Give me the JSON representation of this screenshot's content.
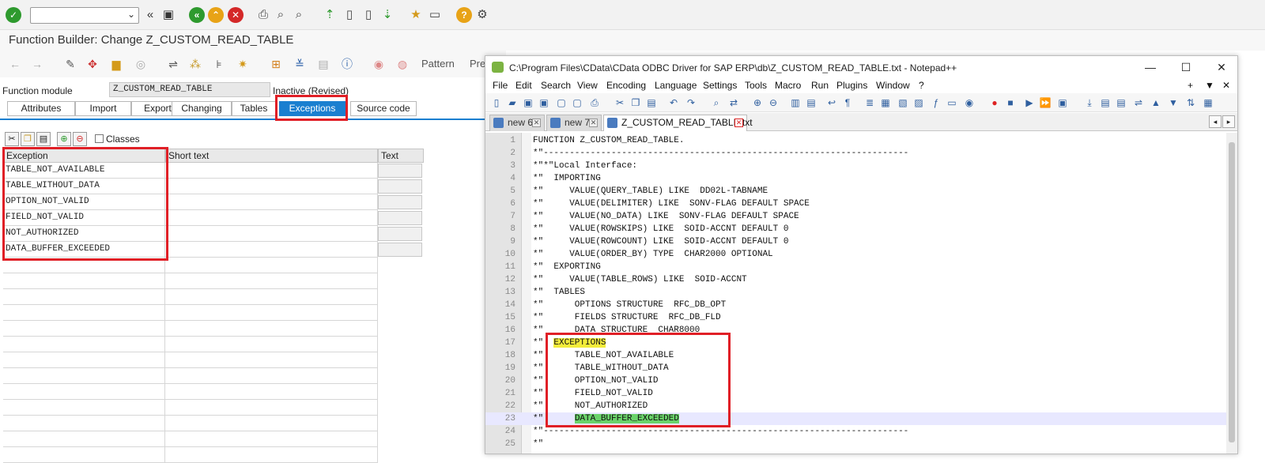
{
  "sap": {
    "title": "Function Builder: Change Z_CUSTOM_READ_TABLE",
    "app_toolbar": {
      "pattern_label": "Pattern",
      "pretty_label": "Pre"
    },
    "function_module": {
      "label": "Function module",
      "value": "Z_CUSTOM_READ_TABLE",
      "status": "Inactive (Revised)"
    },
    "tabs": [
      {
        "label": "Attributes"
      },
      {
        "label": "Import"
      },
      {
        "label": "Export"
      },
      {
        "label": "Changing"
      },
      {
        "label": "Tables"
      },
      {
        "label": "Exceptions"
      },
      {
        "label": "Source code"
      }
    ],
    "active_tab": "Exceptions",
    "classes_label": "Classes",
    "table": {
      "headers": {
        "exception": "Exception",
        "short_text": "Short text",
        "text": "Text"
      },
      "rows": [
        "TABLE_NOT_AVAILABLE",
        "TABLE_WITHOUT_DATA",
        "OPTION_NOT_VALID",
        "FIELD_NOT_VALID",
        "NOT_AUTHORIZED",
        "DATA_BUFFER_EXCEEDED"
      ]
    },
    "colors": {
      "tab_active": "#1a7fd0",
      "highlight_box": "#e01f26"
    }
  },
  "notepad": {
    "title": "C:\\Program Files\\CData\\CData ODBC Driver for SAP ERP\\db\\Z_CUSTOM_READ_TABLE.txt - Notepad++",
    "menu": [
      "File",
      "Edit",
      "Search",
      "View",
      "Encoding",
      "Language",
      "Settings",
      "Tools",
      "Macro",
      "Run",
      "Plugins",
      "Window",
      "?"
    ],
    "menu_right": [
      "+",
      "▼",
      "✕"
    ],
    "file_tabs": [
      "new 6",
      "new 7",
      "Z_CUSTOM_READ_TABLE.txt"
    ],
    "lines": [
      {
        "n": "1",
        "text": "FUNCTION Z_CUSTOM_READ_TABLE."
      },
      {
        "n": "2",
        "text": "*\"----------------------------------------------------------------------"
      },
      {
        "n": "3",
        "text": "*\"*\"Local Interface:"
      },
      {
        "n": "4",
        "text": "*\"  IMPORTING"
      },
      {
        "n": "5",
        "text": "*\"     VALUE(QUERY_TABLE) LIKE  DD02L-TABNAME"
      },
      {
        "n": "6",
        "text": "*\"     VALUE(DELIMITER) LIKE  SONV-FLAG DEFAULT SPACE"
      },
      {
        "n": "7",
        "text": "*\"     VALUE(NO_DATA) LIKE  SONV-FLAG DEFAULT SPACE"
      },
      {
        "n": "8",
        "text": "*\"     VALUE(ROWSKIPS) LIKE  SOID-ACCNT DEFAULT 0"
      },
      {
        "n": "9",
        "text": "*\"     VALUE(ROWCOUNT) LIKE  SOID-ACCNT DEFAULT 0"
      },
      {
        "n": "10",
        "text": "*\"     VALUE(ORDER_BY) TYPE  CHAR2000 OPTIONAL"
      },
      {
        "n": "11",
        "text": "*\"  EXPORTING"
      },
      {
        "n": "12",
        "text": "*\"     VALUE(TABLE_ROWS) LIKE  SOID-ACCNT"
      },
      {
        "n": "13",
        "text": "*\"  TABLES"
      },
      {
        "n": "14",
        "text": "*\"      OPTIONS STRUCTURE  RFC_DB_OPT"
      },
      {
        "n": "15",
        "text": "*\"      FIELDS STRUCTURE  RFC_DB_FLD"
      },
      {
        "n": "16",
        "text": "*\"      DATA STRUCTURE  CHAR8000"
      },
      {
        "n": "17",
        "prefix": "*\"  ",
        "hl": "EXCEPTIONS",
        "hl_type": "yellow"
      },
      {
        "n": "18",
        "text": "*\"      TABLE_NOT_AVAILABLE"
      },
      {
        "n": "19",
        "text": "*\"      TABLE_WITHOUT_DATA"
      },
      {
        "n": "20",
        "text": "*\"      OPTION_NOT_VALID"
      },
      {
        "n": "21",
        "text": "*\"      FIELD_NOT_VALID"
      },
      {
        "n": "22",
        "text": "*\"      NOT_AUTHORIZED"
      },
      {
        "n": "23",
        "prefix": "*\"      ",
        "hl": "DATA_BUFFER_EXCEEDED",
        "hl_type": "green"
      },
      {
        "n": "24",
        "text": "*\"----------------------------------------------------------------------"
      },
      {
        "n": "25",
        "text": "*\""
      }
    ]
  }
}
